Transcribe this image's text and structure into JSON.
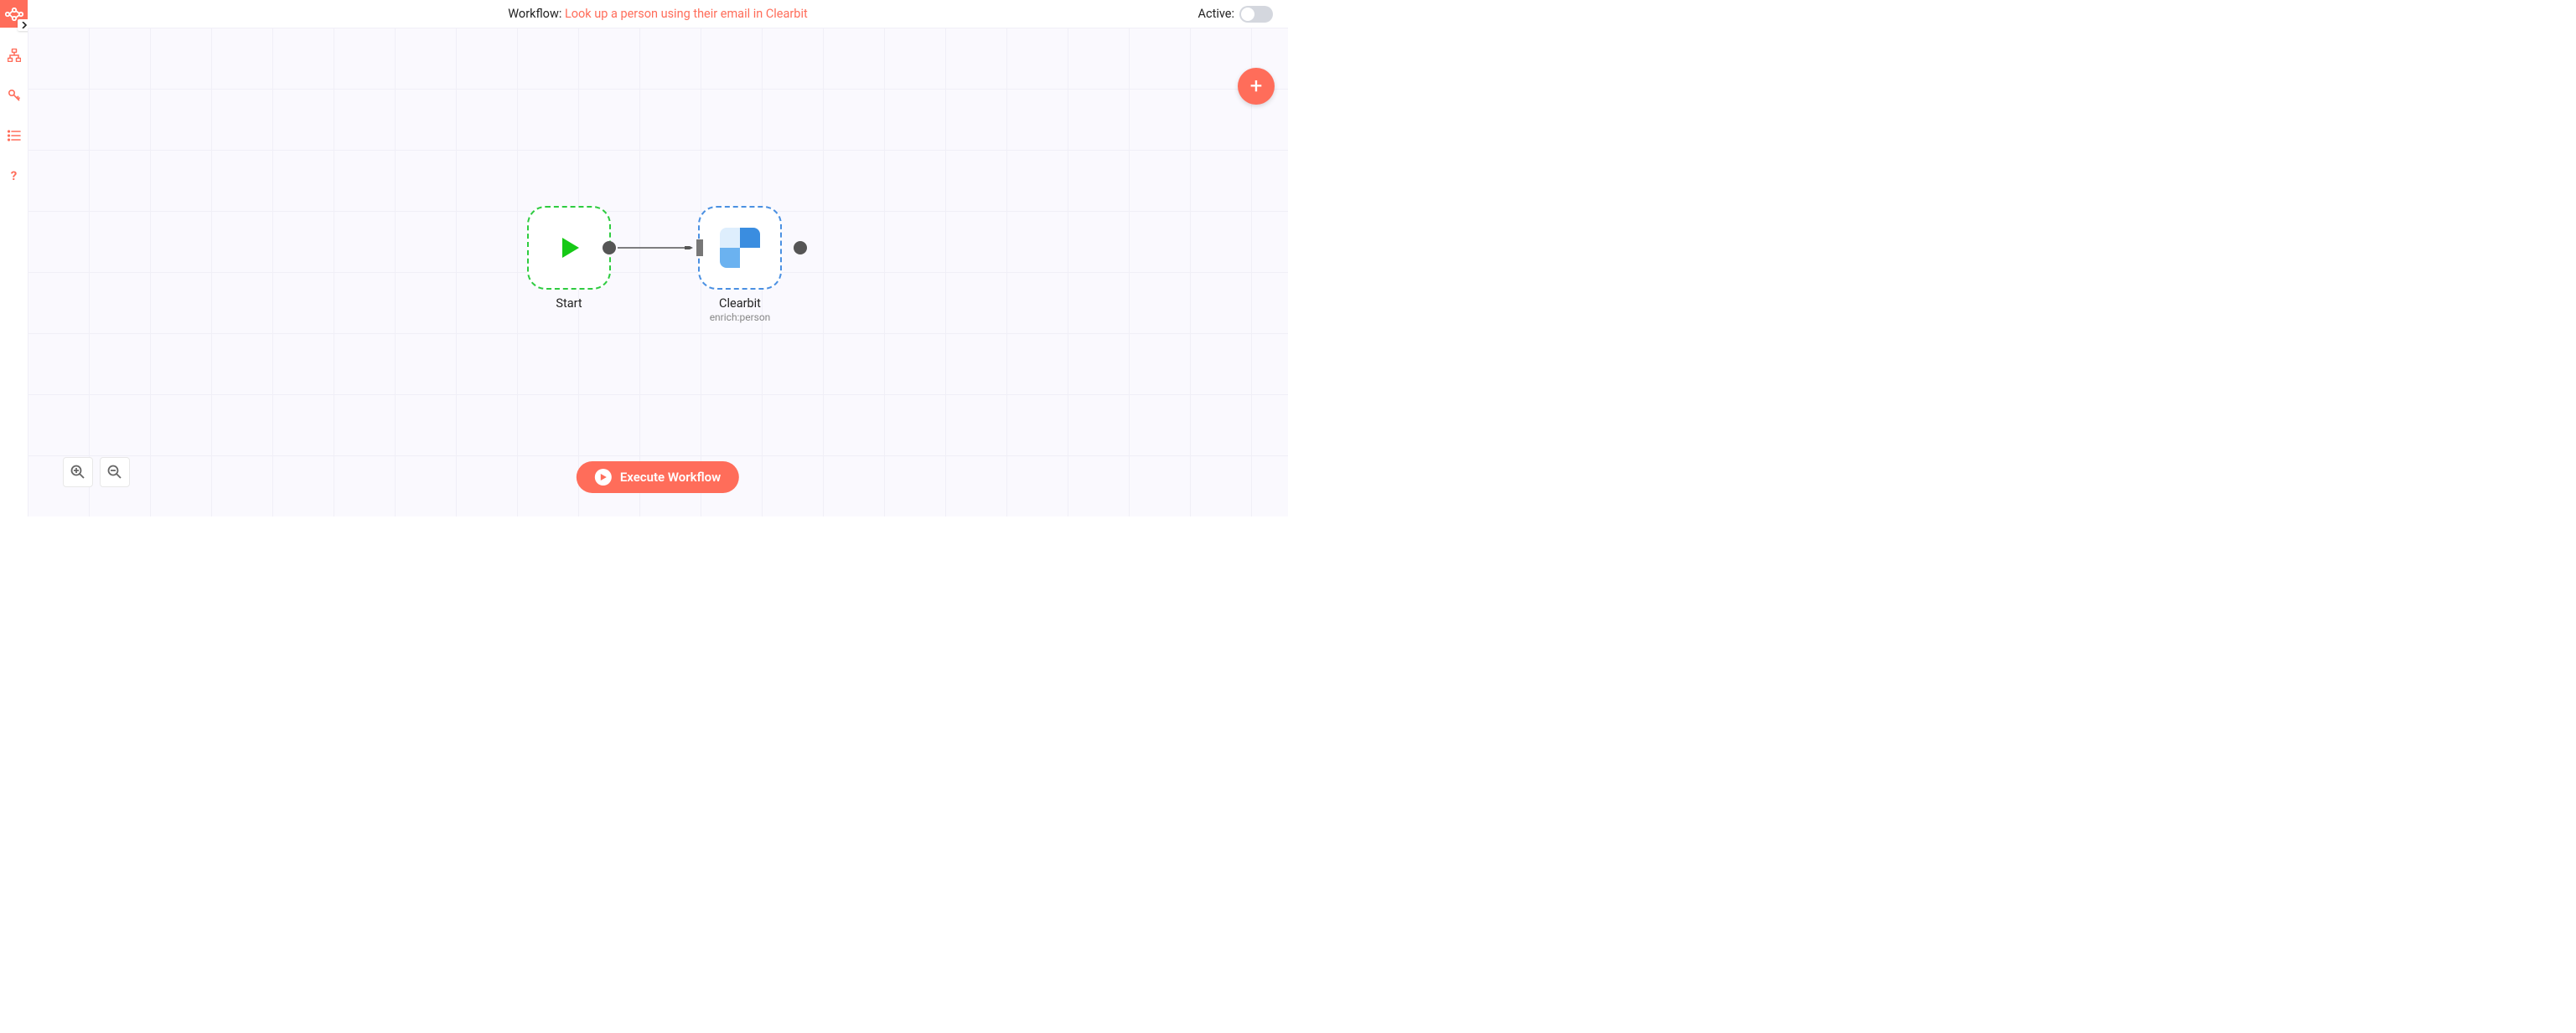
{
  "header": {
    "workflow_prefix": "Workflow: ",
    "workflow_name": "Look up a person using their email in Clearbit",
    "active_label": "Active:",
    "active_state": false
  },
  "sidebar": {
    "logo": "n8n-logo",
    "items": [
      {
        "name": "workflows",
        "icon": "network-icon"
      },
      {
        "name": "credentials",
        "icon": "key-icon"
      },
      {
        "name": "executions",
        "icon": "list-icon"
      },
      {
        "name": "help",
        "icon": "question-icon"
      }
    ]
  },
  "canvas": {
    "nodes": [
      {
        "id": "start",
        "label": "Start",
        "sublabel": "",
        "type": "trigger"
      },
      {
        "id": "clearbit",
        "label": "Clearbit",
        "sublabel": "enrich:person",
        "type": "action"
      }
    ],
    "connections": [
      {
        "from": "start",
        "to": "clearbit"
      }
    ]
  },
  "controls": {
    "execute_label": "Execute Workflow",
    "zoom_in": "zoom-in",
    "zoom_out": "zoom-out",
    "add_node": "+"
  },
  "colors": {
    "accent": "#ff6d5a",
    "start_border": "#2ecc40",
    "clearbit_border": "#4a90e2"
  }
}
